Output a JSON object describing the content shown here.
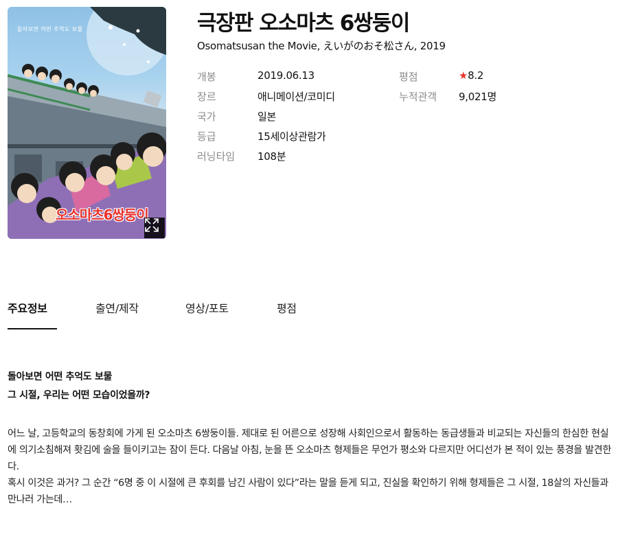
{
  "movie": {
    "title": "극장판 오소마츠 6쌍둥이",
    "subtitle": "Osomatsusan the Movie, えいがのおそ松さん, 2019"
  },
  "poster": {
    "tagline": "돌아보면 어떤 추억도 보물",
    "title_art": "오소마츠6쌍둥이",
    "expand_icon": "expand-icon"
  },
  "info": {
    "release_label": "개봉",
    "release_value": "2019.06.13",
    "genre_label": "장르",
    "genre_value": "애니메이션/코미디",
    "country_label": "국가",
    "country_value": "일본",
    "rating_label": "등급",
    "rating_value": "15세이상관람가",
    "runtime_label": "러닝타임",
    "runtime_value": "108분",
    "score_label": "평점",
    "score_star": "★",
    "score_value": "8.2",
    "audience_label": "누적관객",
    "audience_value": "9,021명"
  },
  "tabs": [
    {
      "label": "주요정보"
    },
    {
      "label": "출연/제작"
    },
    {
      "label": "영상/포토"
    },
    {
      "label": "평점"
    }
  ],
  "content": {
    "tagline_1": "돌아보면 어떤 추억도 보물",
    "tagline_2": "그 시절, 우리는 어떤 모습이었을까?",
    "synopsis_1": "어느 날, 고등학교의 동창회에 가게 된 오소마츠 6쌍둥이들. 제대로 된 어른으로 성장해 사회인으로서 활동하는 동급생들과 비교되는 자신들의 한심한 현실에 의기소침해져 홧김에 술을 들이키고는 잠이 든다. 다음날 아침, 눈을 뜬 오소마츠 형제들은 무언가 평소와 다르지만 어디선가 본 적이 있는 풍경을 발견한다.",
    "synopsis_2": "혹시 이것은 과거? 그 순간 “6명 중 이 시절에 큰 후회를 남긴 사람이 있다”라는 말을 듣게 되고, 진실을 확인하기 위해 형제들은 그 시절, 18살의 자신들과 만나러 가는데…"
  },
  "colors": {
    "accent_red": "#e8322b",
    "label_gray": "#8a8a8a"
  }
}
